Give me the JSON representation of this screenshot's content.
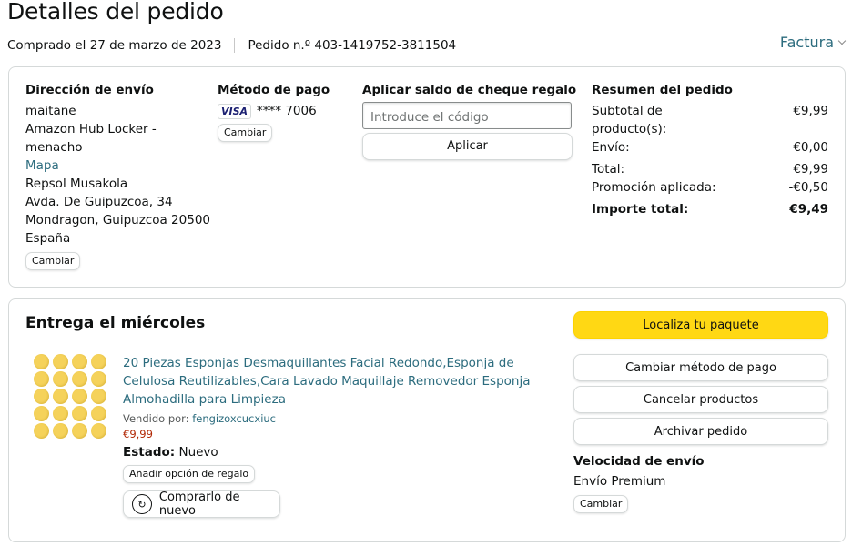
{
  "header": {
    "title": "Detalles del pedido",
    "ordered": "Comprado el 27 de marzo de 2023",
    "order_number": "Pedido n.º 403-1419752-3811504",
    "invoice": "Factura"
  },
  "shipping": {
    "heading": "Dirección de envío",
    "name": "maitane",
    "line1": "Amazon Hub Locker - menacho",
    "map_link": "Mapa",
    "line2": "Repsol Musakola",
    "line3": "Avda. De Guipuzcoa, 34",
    "line4": "Mondragon, Guipuzcoa 20500",
    "country": "España",
    "change": "Cambiar"
  },
  "payment": {
    "heading": "Método de pago",
    "card_brand": "VISA",
    "card_digits": "**** 7006",
    "change": "Cambiar"
  },
  "gift": {
    "heading": "Aplicar saldo de cheque regalo",
    "placeholder": "Introduce el código",
    "apply": "Aplicar"
  },
  "summary": {
    "heading": "Resumen del pedido",
    "subtotal_label": "Subtotal de producto(s):",
    "subtotal_value": "€9,99",
    "shipping_label": "Envío:",
    "shipping_value": "€0,00",
    "total_label": "Total:",
    "total_value": "€9,99",
    "promo_label": "Promoción aplicada:",
    "promo_value": "-€0,50",
    "grand_label": "Importe total:",
    "grand_value": "€9,49"
  },
  "delivery": {
    "heading": "Entrega el miércoles",
    "product_title": "20 Piezas Esponjas Desmaquillantes Facial Redondo,Esponja de Celulosa Reutilizables,Cara Lavado Maquillaje Removedor Esponja Almohadilla para Limpieza",
    "sold_by_label": "Vendido por:",
    "seller": "fengizoxcucxiuc",
    "price": "€9,99",
    "condition_label": "Estado:",
    "condition_value": "Nuevo",
    "gift_option": "Añadir opción de regalo",
    "buy_again": "Comprarlo de nuevo"
  },
  "actions": {
    "track": "Localiza tu paquete",
    "change_payment": "Cambiar método de pago",
    "cancel": "Cancelar productos",
    "archive": "Archivar pedido",
    "speed_heading": "Velocidad de envío",
    "speed_value": "Envío Premium",
    "speed_change": "Cambiar"
  },
  "colors": {
    "link": "#2c6c7e",
    "price": "#b12704",
    "primary_button": "#ffd814"
  }
}
